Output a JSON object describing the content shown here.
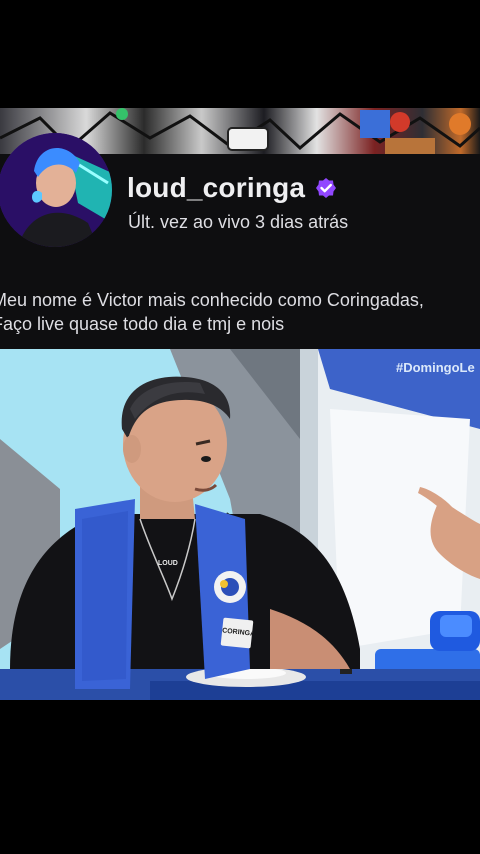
{
  "channel": {
    "username": "loud_coringa",
    "verified_icon": "verified-badge-icon",
    "last_live": "Últ. vez ao vivo 3 dias atrás",
    "bio_lines": [
      "Meu nome é Victor mais conhecido como Coringadas,",
      "Faço live quase todo dia e tmj e nois"
    ],
    "accent_color": "#9147ff",
    "background_color": "#0e0e10"
  },
  "video": {
    "hashtag": "#DomingoLe",
    "vest_logo": "LOUD",
    "name_tag": "CORINGA"
  }
}
